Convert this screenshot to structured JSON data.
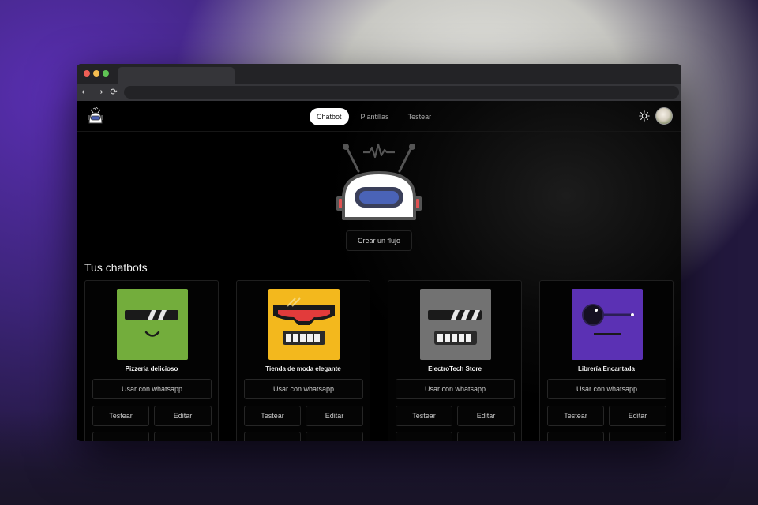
{
  "nav": {
    "tabs": [
      {
        "label": "Chatbot",
        "active": true
      },
      {
        "label": "Plantillas",
        "active": false
      },
      {
        "label": "Testear",
        "active": false
      }
    ],
    "theme_icon": "sun-icon"
  },
  "hero": {
    "create_label": "Crear un flujo"
  },
  "section": {
    "title": "Tus chatbots"
  },
  "buttons": {
    "whatsapp": "Usar con whatsapp",
    "test": "Testear",
    "edit": "Editar"
  },
  "chatbots": [
    {
      "name": "Pizzeria delicioso",
      "color": "#73ad3c"
    },
    {
      "name": "Tienda de moda elegante",
      "color": "#f3b81d"
    },
    {
      "name": "ElectroTech Store",
      "color": "#727272"
    },
    {
      "name": "Librería Encantada",
      "color": "#5b31b4"
    }
  ],
  "colors": {
    "accent": "#ffffff",
    "background": "#000000"
  }
}
